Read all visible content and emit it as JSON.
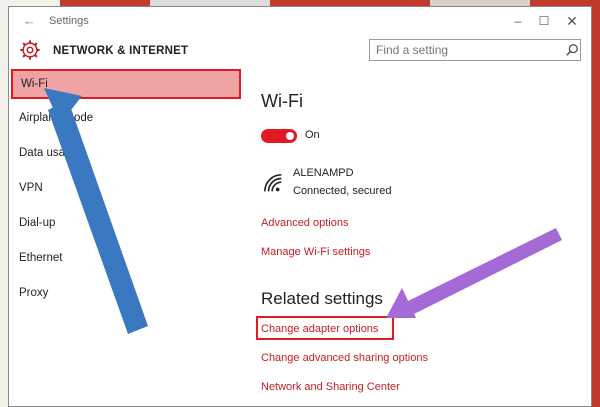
{
  "window": {
    "title": "Settings",
    "back_icon": "back-arrow-icon",
    "controls": [
      "minimize",
      "maximize",
      "close"
    ]
  },
  "header": {
    "section_title": "NETWORK & INTERNET",
    "search_placeholder": "Find a setting"
  },
  "sidebar": {
    "items": [
      {
        "label": "Wi-Fi",
        "active": true
      },
      {
        "label": "Airplane mode",
        "active": false
      },
      {
        "label": "Data usage",
        "active": false
      },
      {
        "label": "VPN",
        "active": false
      },
      {
        "label": "Dial-up",
        "active": false
      },
      {
        "label": "Ethernet",
        "active": false
      },
      {
        "label": "Proxy",
        "active": false
      }
    ]
  },
  "main": {
    "title": "Wi-Fi",
    "toggle_state": "On",
    "network": {
      "name": "ALENAMPD",
      "status": "Connected, secured"
    },
    "links": {
      "advanced": "Advanced options",
      "manage": "Manage Wi-Fi settings"
    },
    "related": {
      "title": "Related settings",
      "adapter": "Change adapter options",
      "sharing": "Change advanced sharing options",
      "center": "Network and Sharing Center"
    }
  },
  "colors": {
    "accent": "#e01b24",
    "link": "#c41e24",
    "active_bg": "#f0a3a3",
    "blue_arrow": "#3b78c2",
    "purple_arrow": "#a56ad6"
  }
}
